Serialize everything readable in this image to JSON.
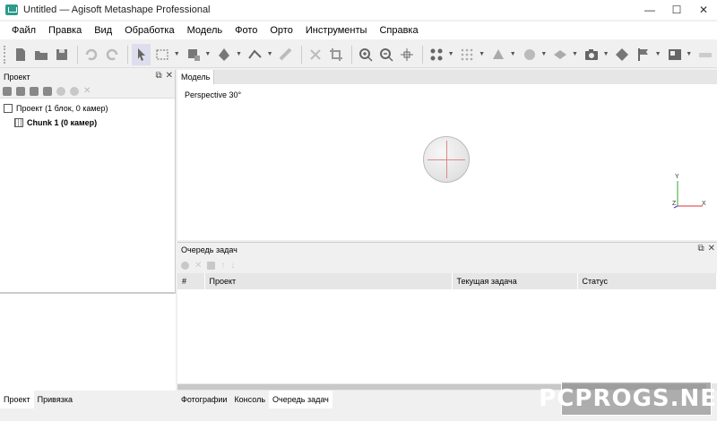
{
  "window": {
    "title": "Untitled — Agisoft Metashape Professional",
    "controls": [
      "—",
      "☐",
      "✕"
    ]
  },
  "menu": [
    {
      "label": "Файл"
    },
    {
      "label": "Правка"
    },
    {
      "label": "Вид"
    },
    {
      "label": "Обработка"
    },
    {
      "label": "Модель"
    },
    {
      "label": "Фото"
    },
    {
      "label": "Орто"
    },
    {
      "label": "Инструменты"
    },
    {
      "label": "Справка"
    }
  ],
  "project_panel": {
    "title": "Проект",
    "tree": {
      "root": "Проект (1 блок, 0 камер)",
      "chunk": "Chunk 1 (0 камер)"
    }
  },
  "model_view": {
    "tab": "Модель",
    "perspective": "Perspective 30°",
    "axes": {
      "y": "Y",
      "x": "X",
      "z": "Z"
    }
  },
  "task_queue": {
    "title": "Очередь задач",
    "columns": [
      "#",
      "Проект",
      "Текущая задача",
      "Статус"
    ]
  },
  "left_bottom_tabs": [
    "Проект",
    "Привязка"
  ],
  "right_bottom_tabs": [
    "Фотографии",
    "Консоль",
    "Очередь задач"
  ],
  "watermark": "PCPROGS.NET"
}
